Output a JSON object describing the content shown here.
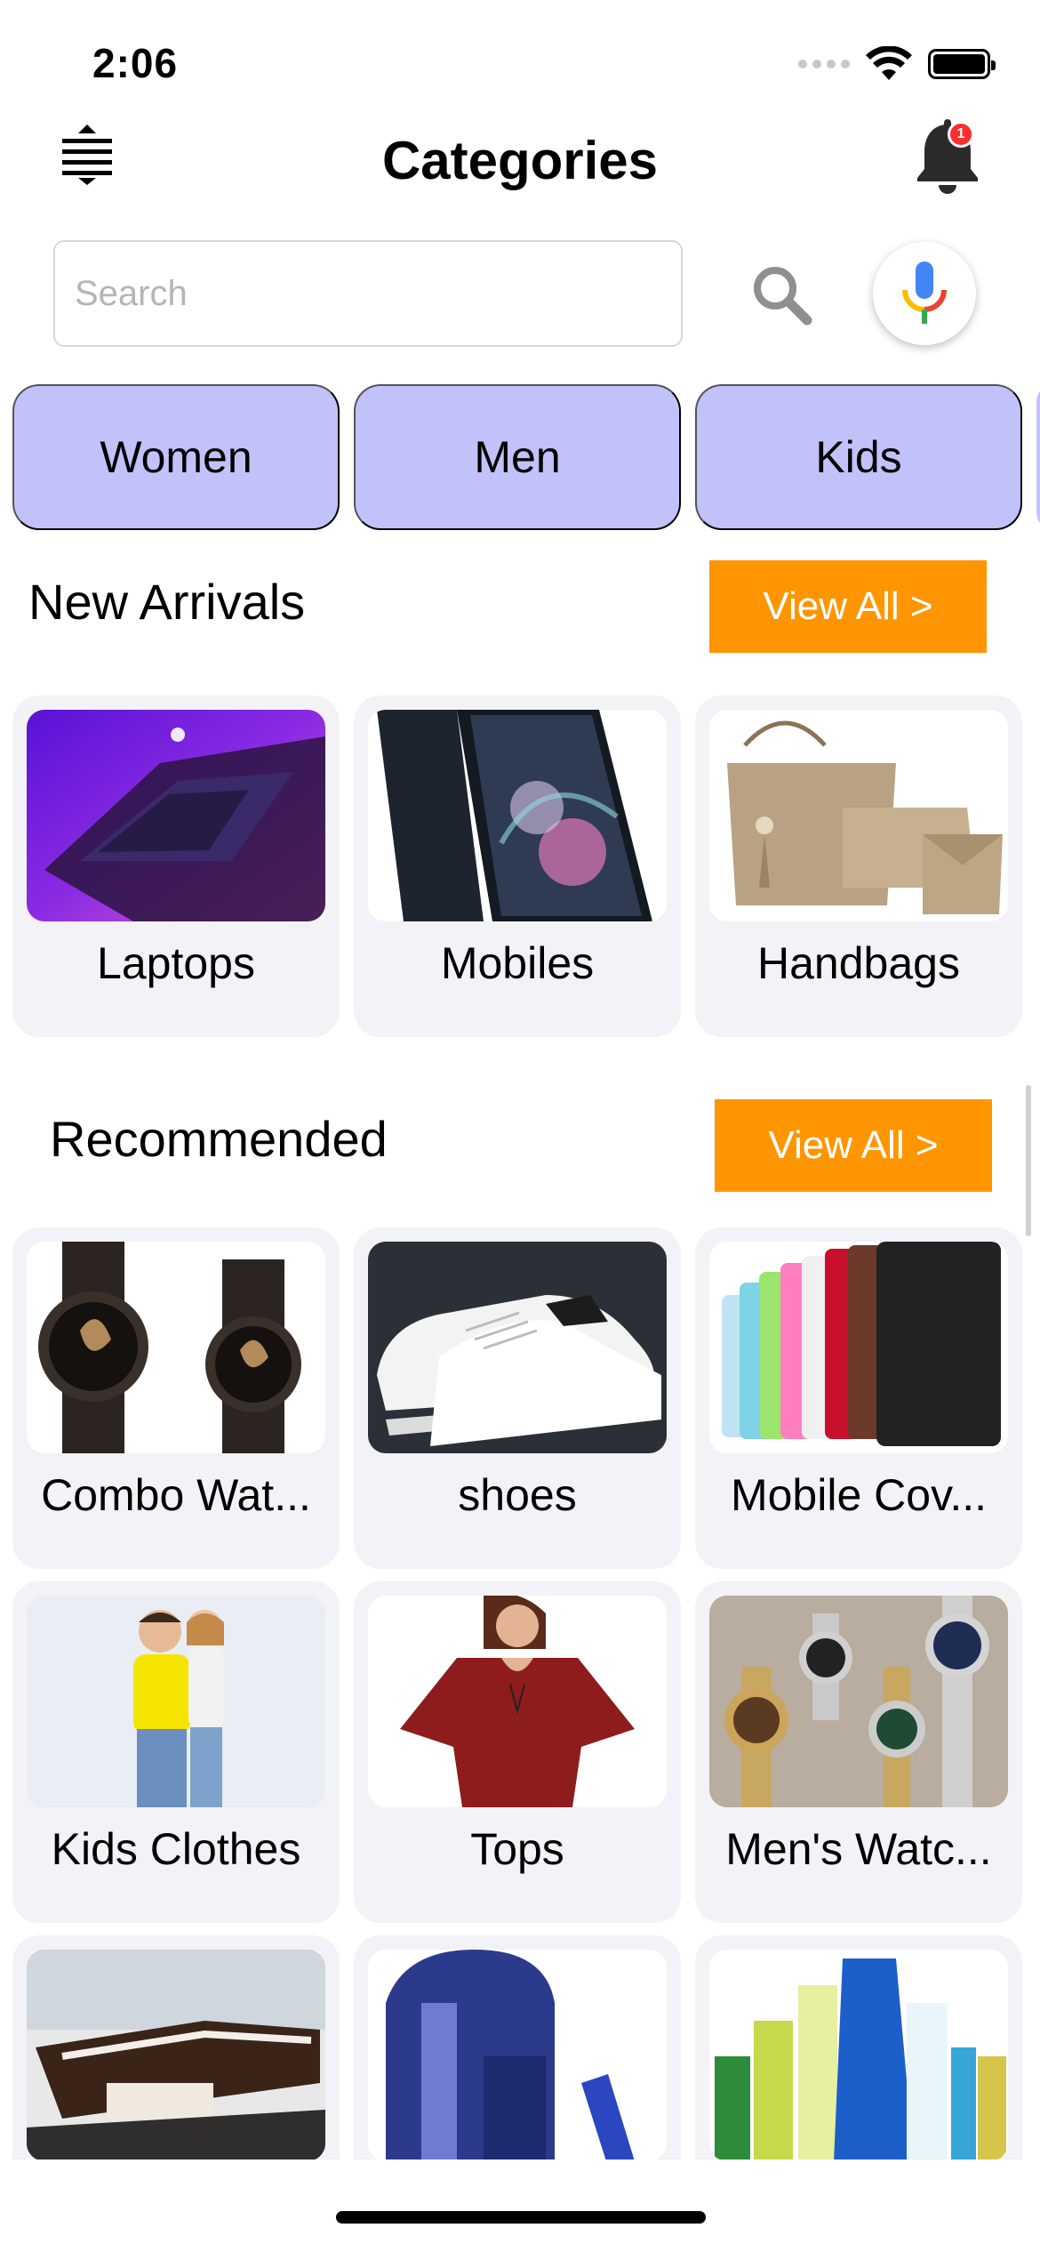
{
  "status_bar": {
    "time": "2:06"
  },
  "header": {
    "title": "Categories",
    "notification_count": "1"
  },
  "search": {
    "placeholder": "Search",
    "value": ""
  },
  "category_tabs": [
    "Women",
    "Men",
    "Kids"
  ],
  "new_arrivals": {
    "title": "New Arrivals",
    "view_all_label": "View All >",
    "items": [
      {
        "label": "Laptops",
        "icon": "laptop-image"
      },
      {
        "label": "Mobiles",
        "icon": "mobile-phone-image"
      },
      {
        "label": "Handbags",
        "icon": "handbag-image"
      }
    ]
  },
  "recommended": {
    "title": "Recommended",
    "view_all_label": "View All >",
    "items": [
      {
        "label": "Combo Wat...",
        "icon": "wristwatch-pair-image"
      },
      {
        "label": "shoes",
        "icon": "sneaker-image"
      },
      {
        "label": "Mobile Cov...",
        "icon": "phone-covers-image"
      },
      {
        "label": "Kids Clothes",
        "icon": "kids-image"
      },
      {
        "label": "Tops",
        "icon": "top-image"
      },
      {
        "label": "Men's Watc...",
        "icon": "mens-watches-image"
      },
      {
        "label": "",
        "icon": "sofa-image"
      },
      {
        "label": "",
        "icon": "backpack-image"
      },
      {
        "label": "",
        "icon": "hair-oil-bottles-image"
      }
    ]
  },
  "colors": {
    "category_pill": "#c2c2fb",
    "view_all": "#ff9500",
    "card_bg": "#f2f2f7",
    "badge": "#ff2d2d"
  }
}
